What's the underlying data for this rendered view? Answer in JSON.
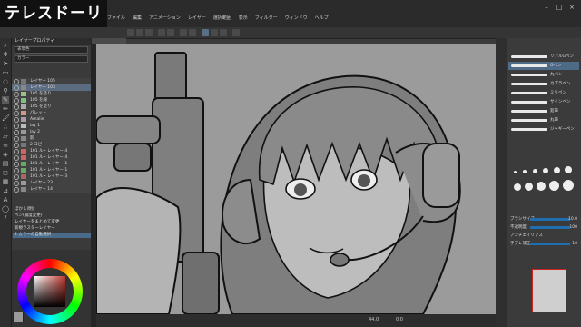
{
  "logo_text": "テレスドーリ",
  "menu": [
    "ファイル",
    "編集",
    "アニメーション",
    "レイヤー",
    "選択範囲",
    "表示",
    "フィルター",
    "ウィンドウ",
    "ヘルプ"
  ],
  "left_panel": {
    "title": "レイヤープロパティ",
    "field1": "表現色",
    "field2": "カラー"
  },
  "layers": [
    "レイヤー 105",
    "レイヤー 103",
    "105 を塗り",
    "105 を線",
    "105 を塗り",
    "パレット",
    "Amalie",
    "lay 1",
    "lay 2",
    "影",
    "2 コピー",
    "101 ル・レイヤー 4",
    "101 ル・レイヤー 4",
    "101 ル・レイヤー 1",
    "101 ル・レイヤー 1",
    "101 ル・レイヤー 3",
    "レイヤー 23",
    "レイヤー 14"
  ],
  "history": [
    "ぼかし(明)",
    "ペン(濃度変更)",
    "レイヤーをまとめて変更",
    "新規ラスターレイヤー",
    "2 カラーの自動選択"
  ],
  "brushes": [
    "リアルGペン",
    "Gペン",
    "丸ペン",
    "カブラペン",
    "ミリペン",
    "サインペン",
    "鉛筆",
    "丸筆",
    "ジャギーペン"
  ],
  "tool_properties": {
    "size_label": "ブラシサイズ",
    "size_value": "10.0",
    "opacity_label": "不透明度",
    "opacity_value": "100",
    "aa_label": "アンチエイリアス",
    "stab_label": "手ブレ補正",
    "stab_value": "10"
  },
  "status": {
    "zoom": "44.0",
    "angle": "0.0"
  },
  "colors": {
    "canvas_bg": "#9b9b9b",
    "accent_blue": "#1f6fb0",
    "thumb_red": "#c22"
  }
}
